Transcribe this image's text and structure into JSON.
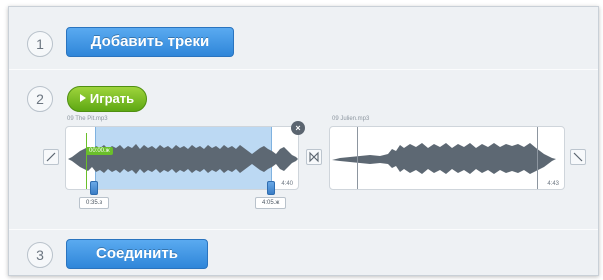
{
  "steps": [
    {
      "number": "1",
      "label": "Добавить треки"
    },
    {
      "number": "2",
      "label": "Играть"
    },
    {
      "number": "3",
      "label": "Соединить"
    }
  ],
  "tracks": [
    {
      "name": "09 The Pit.mp3",
      "end_time": "4:40",
      "cursor_time": "00:00.ж",
      "start_time": "0:35.з",
      "stop_time": "4:05.ж"
    },
    {
      "name": "09 Julien.mp3",
      "end_time": "4:43"
    }
  ],
  "icons": {
    "fade_in": "fade-in-icon",
    "fade_out": "fade-out-icon",
    "crossfade": "crossfade-icon",
    "close": "close-icon",
    "play": "play-icon"
  },
  "colors": {
    "accent_blue": "#3a8fe0",
    "play_green": "#7cc22a",
    "selection": "#bcd9f3",
    "waveform": "#5d6873"
  }
}
